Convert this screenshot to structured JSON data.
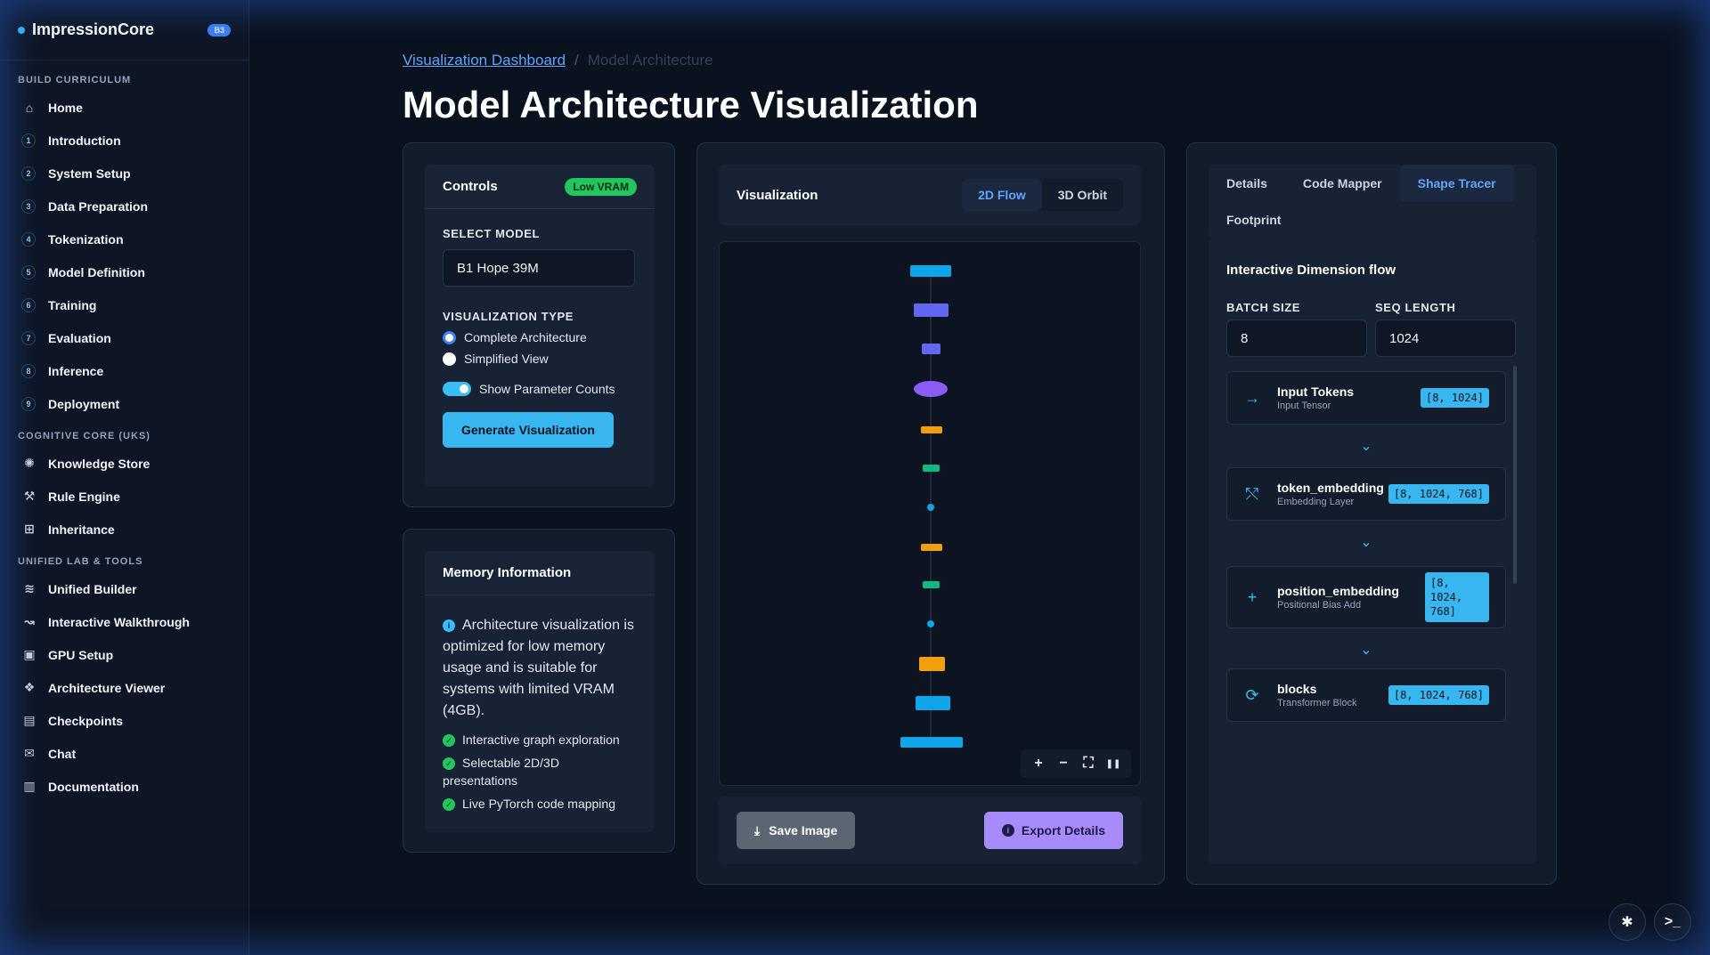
{
  "brand": {
    "name": "ImpressionCore",
    "badge": "B3"
  },
  "sidebar": {
    "sections": [
      {
        "heading": "BUILD CURRICULUM",
        "items": [
          {
            "icon": "home-icon",
            "label": "Home"
          },
          {
            "num": "1",
            "label": "Introduction"
          },
          {
            "num": "2",
            "label": "System Setup"
          },
          {
            "num": "3",
            "label": "Data Preparation"
          },
          {
            "num": "4",
            "label": "Tokenization"
          },
          {
            "num": "5",
            "label": "Model Definition"
          },
          {
            "num": "6",
            "label": "Training"
          },
          {
            "num": "7",
            "label": "Evaluation"
          },
          {
            "num": "8",
            "label": "Inference"
          },
          {
            "num": "9",
            "label": "Deployment"
          }
        ]
      },
      {
        "heading": "COGNITIVE CORE (UKS)",
        "items": [
          {
            "icon": "brain-icon",
            "label": "Knowledge Store"
          },
          {
            "icon": "gavel-icon",
            "label": "Rule Engine"
          },
          {
            "icon": "sitemap-icon",
            "label": "Inheritance"
          }
        ]
      },
      {
        "heading": "UNIFIED LAB & TOOLS",
        "items": [
          {
            "icon": "layers-icon",
            "label": "Unified Builder"
          },
          {
            "icon": "route-icon",
            "label": "Interactive Walkthrough"
          },
          {
            "icon": "chip-icon",
            "label": "GPU Setup"
          },
          {
            "icon": "cubes-icon",
            "label": "Architecture Viewer"
          },
          {
            "icon": "save-icon",
            "label": "Checkpoints"
          },
          {
            "icon": "chat-icon",
            "label": "Chat"
          },
          {
            "icon": "book-icon",
            "label": "Documentation"
          }
        ]
      }
    ]
  },
  "breadcrumb": {
    "link": "Visualization Dashboard",
    "sep": "/",
    "current": "Model Architecture"
  },
  "page_title": "Model Architecture Visualization",
  "controls": {
    "title": "Controls",
    "badge": "Low VRAM",
    "select_model_label": "SELECT MODEL",
    "select_model_value": "B1 Hope 39M",
    "viz_type_label": "VISUALIZATION TYPE",
    "viz_options": [
      "Complete Architecture",
      "Simplified View"
    ],
    "viz_selected": 0,
    "toggle_label": "Show Parameter Counts",
    "toggle_on": true,
    "generate_label": "Generate Visualization"
  },
  "memory": {
    "title": "Memory Information",
    "text": "Architecture visualization is optimized for low memory usage and is suitable for systems with limited VRAM (4GB).",
    "features": [
      "Interactive graph exploration",
      "Selectable 2D/3D presentations",
      "Live PyTorch code mapping"
    ]
  },
  "visualization": {
    "title": "Visualization",
    "tabs": [
      "2D Flow",
      "3D Orbit"
    ],
    "active_tab": 0,
    "controls": [
      "+",
      "−",
      "⛶",
      "❚❚"
    ],
    "save_label": "Save Image",
    "export_label": "Export Details"
  },
  "right_panel": {
    "tabs": [
      "Details",
      "Code Mapper",
      "Shape Tracer",
      "Footprint"
    ],
    "active_tab": 2,
    "section_title": "Interactive Dimension flow",
    "batch_label": "BATCH SIZE",
    "batch_value": "8",
    "seq_label": "SEQ LENGTH",
    "seq_value": "1024",
    "nodes": [
      {
        "icon": "arrow-right-icon",
        "name": "Input Tokens",
        "sub": "Input Tensor",
        "shape": "[8, 1024]"
      },
      {
        "icon": "nodes-icon",
        "name": "token_embedding",
        "sub": "Embedding Layer",
        "shape": "[8, 1024, 768]"
      },
      {
        "icon": "plus-icon",
        "name": "position_embedding",
        "sub": "Positional Bias Add",
        "shape": "[8, 1024, 768]"
      },
      {
        "icon": "refresh-icon",
        "name": "blocks",
        "sub": "Transformer Block",
        "shape": "[8, 1024, 768]"
      }
    ]
  },
  "colors": {
    "accent": "#38b6f0",
    "success": "#22c55e",
    "purple": "#a78bfa",
    "orange": "#f59e0b",
    "teal": "#10b981",
    "indigo": "#6366f1"
  }
}
